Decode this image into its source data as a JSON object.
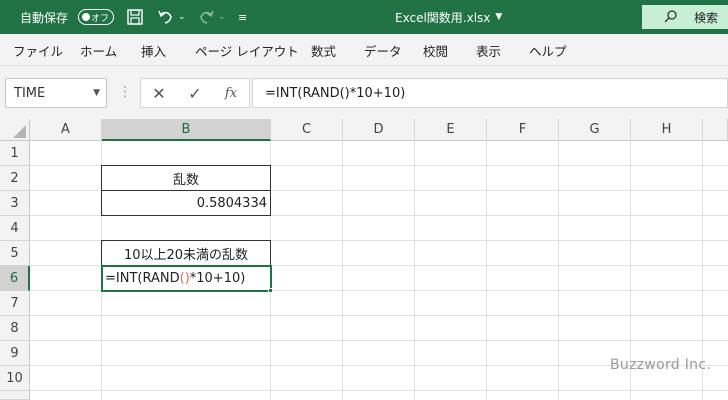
{
  "titlebar": {
    "autosave_label": "自動保存",
    "autosave_state": "オフ",
    "filename": "Excel関数用.xlsx",
    "search_label": "検索"
  },
  "ribbon": {
    "tabs": [
      "ファイル",
      "ホーム",
      "挿入",
      "ページ レイアウト",
      "数式",
      "データ",
      "校閲",
      "表示",
      "ヘルプ"
    ]
  },
  "formula_bar": {
    "name_box": "TIME",
    "formula": "=INT(RAND()*10+10)"
  },
  "grid": {
    "columns": [
      "A",
      "B",
      "C",
      "D",
      "E",
      "F",
      "G",
      "H"
    ],
    "rows": [
      "1",
      "2",
      "3",
      "4",
      "5",
      "6",
      "7",
      "8",
      "9",
      "10"
    ],
    "selected_column": "B",
    "selected_row": "6",
    "cells": {
      "B2": "乱数",
      "B3": "0.5804334",
      "B5": "10以上20未満の乱数",
      "B6_parts": [
        "=INT(RAND",
        "(",
        ")",
        "*10+10)"
      ]
    }
  },
  "colors": {
    "excel_green": "#217346",
    "ref_paren": "#e36c5b"
  },
  "watermark": "Buzzword Inc."
}
